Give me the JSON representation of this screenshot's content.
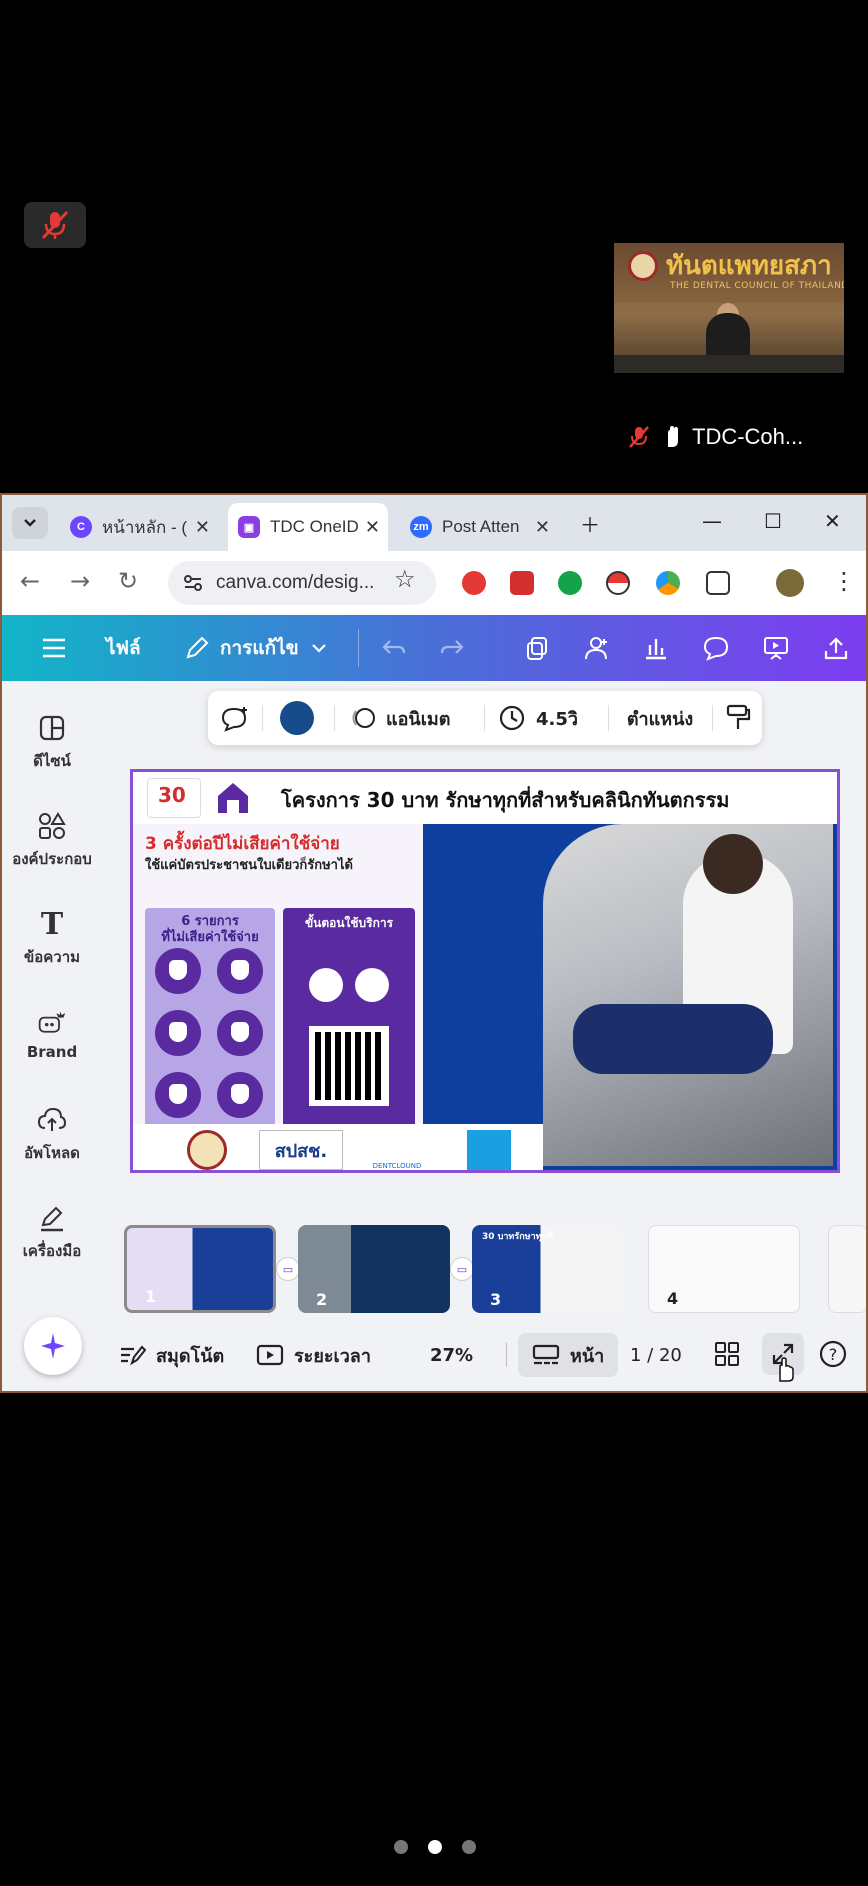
{
  "call": {
    "participant_name": "TDC-Coh...",
    "video_banner_title": "ทันตแพทยสภา",
    "video_banner_subtitle": "THE DENTAL COUNCIL OF THAILAND"
  },
  "browser": {
    "tabs": [
      {
        "label": "หน้าหลัก - (",
        "icon": "canva-favicon",
        "active": false
      },
      {
        "label": "TDC OneID",
        "icon": "tdc-favicon",
        "active": true
      },
      {
        "label": "Post Atten",
        "icon": "zoom-favicon",
        "active": false
      }
    ],
    "url": "canva.com/desig..."
  },
  "canva": {
    "header": {
      "file_label": "ไฟล์",
      "edit_label": "การแก้ไข"
    },
    "sidebar": [
      {
        "label": "ดีไซน์",
        "icon": "design-icon"
      },
      {
        "label": "องค์ประกอบ",
        "icon": "elements-icon"
      },
      {
        "label": "ข้อความ",
        "icon": "text-icon"
      },
      {
        "label": "Brand",
        "icon": "brand-icon"
      },
      {
        "label": "อัพโหลด",
        "icon": "upload-icon"
      },
      {
        "label": "เครื่องมือ",
        "icon": "tools-icon"
      }
    ],
    "toolbar": {
      "animate_label": "แอนิเมต",
      "duration": "4.5วิ",
      "position_label": "ตำแหน่ง",
      "color": "#164c8a"
    },
    "slide": {
      "title": "โครงการ 30 บาท รักษาทุกที่สำหรับคลินิกทันตกรรม",
      "headline": "3 ครั้งต่อปีไม่เสียค่าใช้จ่าย",
      "subheadline": "ใช้แค่บัตรประชาชนใบเดียวก็รักษาได้",
      "left_box_title": "6 รายการ\nที่ไม่เสียค่าใช้จ่าย",
      "right_box_title": "ขั้นตอนใช้บริการ",
      "logo_30_text": "30",
      "footer_logo_text": "สปสช.",
      "footer_logo_3": "DENTCLOUND"
    },
    "pages": [
      {
        "num": "1"
      },
      {
        "num": "2"
      },
      {
        "num": "3"
      },
      {
        "num": "4"
      }
    ],
    "page3_caption": "30 บาทรักษาทุกที่",
    "footer": {
      "notes_label": "สมุดโน้ต",
      "timeline_label": "ระยะเวลา",
      "zoom": "27%",
      "page_view_label": "หน้า",
      "page_counter": "1 / 20"
    }
  },
  "colors": {
    "header_gradient_start": "#11b5c8",
    "header_gradient_end": "#7d3cf0",
    "slide_border": "#8b4fd6"
  }
}
